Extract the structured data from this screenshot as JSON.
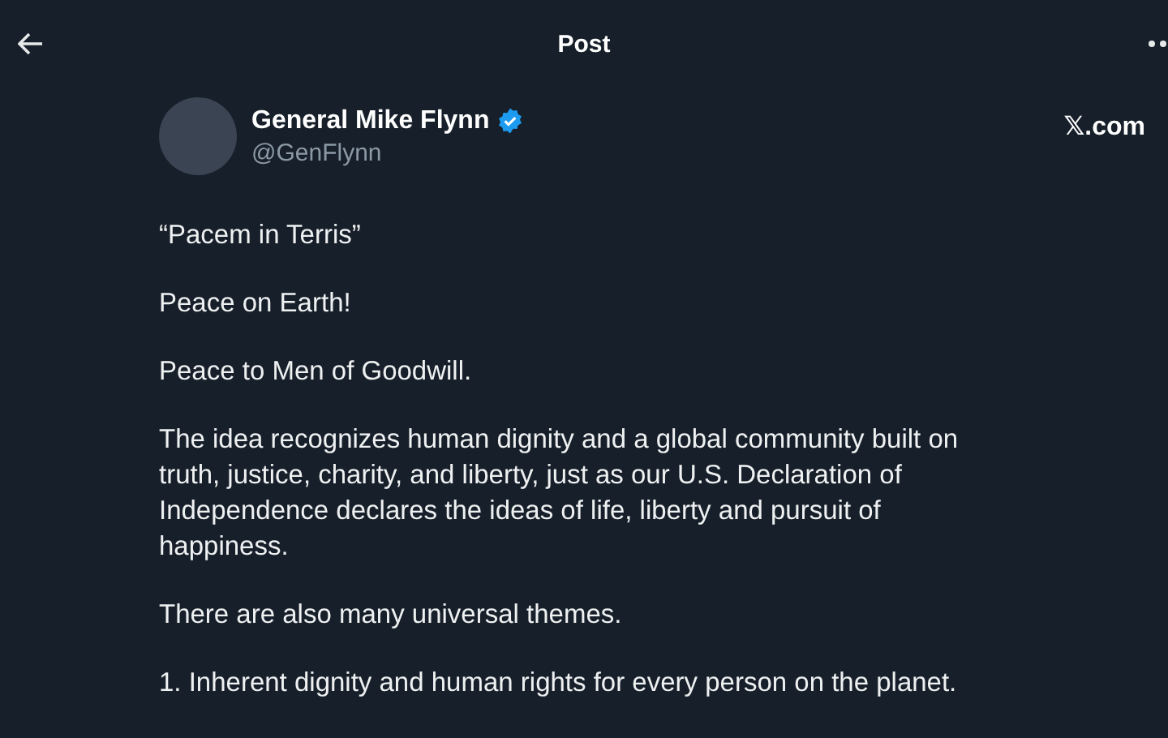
{
  "top_bar": {
    "title": "Post"
  },
  "author": {
    "name": "General Mike Flynn",
    "handle": "@GenFlynn",
    "verified": true
  },
  "source": "𝕏.com",
  "paragraphs": [
    "“Pacem in Terris”",
    "Peace on Earth!",
    "Peace to Men of Goodwill.",
    "The idea recognizes human dignity and a global community built on truth, justice, charity, and liberty, just as our U.S. Declaration of Independence declares the ideas of life, liberty and pursuit of happiness.",
    "There are also many universal themes.",
    "1. Inherent dignity and human rights for every person on the planet."
  ]
}
